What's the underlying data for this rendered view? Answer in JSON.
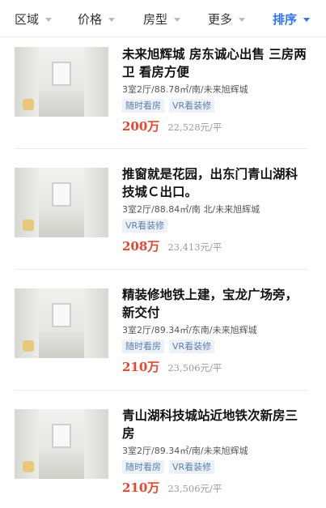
{
  "filters": [
    {
      "label": "区域",
      "active": false
    },
    {
      "label": "价格",
      "active": false
    },
    {
      "label": "房型",
      "active": false
    },
    {
      "label": "更多",
      "active": false
    },
    {
      "label": "排序",
      "active": true
    }
  ],
  "listings": [
    {
      "title": "未来旭辉城 房东诚心出售 三房两卫 看房方便",
      "meta": "3室2厅/88.78㎡/南/未来旭辉城",
      "tags": [
        "随时看房",
        "VR看装修"
      ],
      "price": "200万",
      "unit_price": "22,528元/平"
    },
    {
      "title": "推窗就是花园，出东门青山湖科技城Ｃ出口。",
      "meta": "3室2厅/88.84㎡/南 北/未来旭辉城",
      "tags": [
        "VR看装修"
      ],
      "price": "208万",
      "unit_price": "23,413元/平"
    },
    {
      "title": "精装修地铁上建，宝龙广场旁，新交付",
      "meta": "3室2厅/89.34㎡/东南/未来旭辉城",
      "tags": [
        "随时看房",
        "VR看装修"
      ],
      "price": "210万",
      "unit_price": "23,506元/平"
    },
    {
      "title": "青山湖科技城站近地铁次新房三房",
      "meta": "3室2厅/89.34㎡/南/未来旭辉城",
      "tags": [
        "随时看房",
        "VR看装修"
      ],
      "price": "210万",
      "unit_price": "23,506元/平"
    }
  ]
}
